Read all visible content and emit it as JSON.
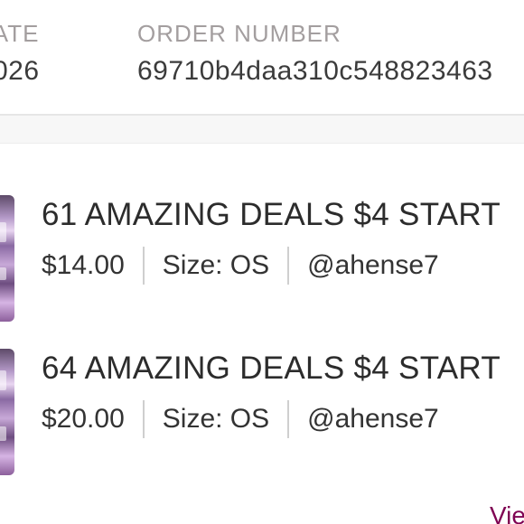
{
  "header": {
    "date_label": "DATE",
    "date_value": "026",
    "order_label": "ORDER NUMBER",
    "order_value": "69710b4daa310c548823463"
  },
  "items": [
    {
      "title": "61 AMAZING DEALS $4 START",
      "price": "$14.00",
      "size": "Size: OS",
      "seller": "@ahense7"
    },
    {
      "title": "64 AMAZING DEALS $4 START",
      "price": "$20.00",
      "size": "Size: OS",
      "seller": "@ahense7"
    }
  ],
  "footer": {
    "view_link": "Vie"
  },
  "colors": {
    "label_gray": "#a39e9f",
    "text_dark": "#2c2c2c",
    "link_purple": "#7f0353"
  }
}
